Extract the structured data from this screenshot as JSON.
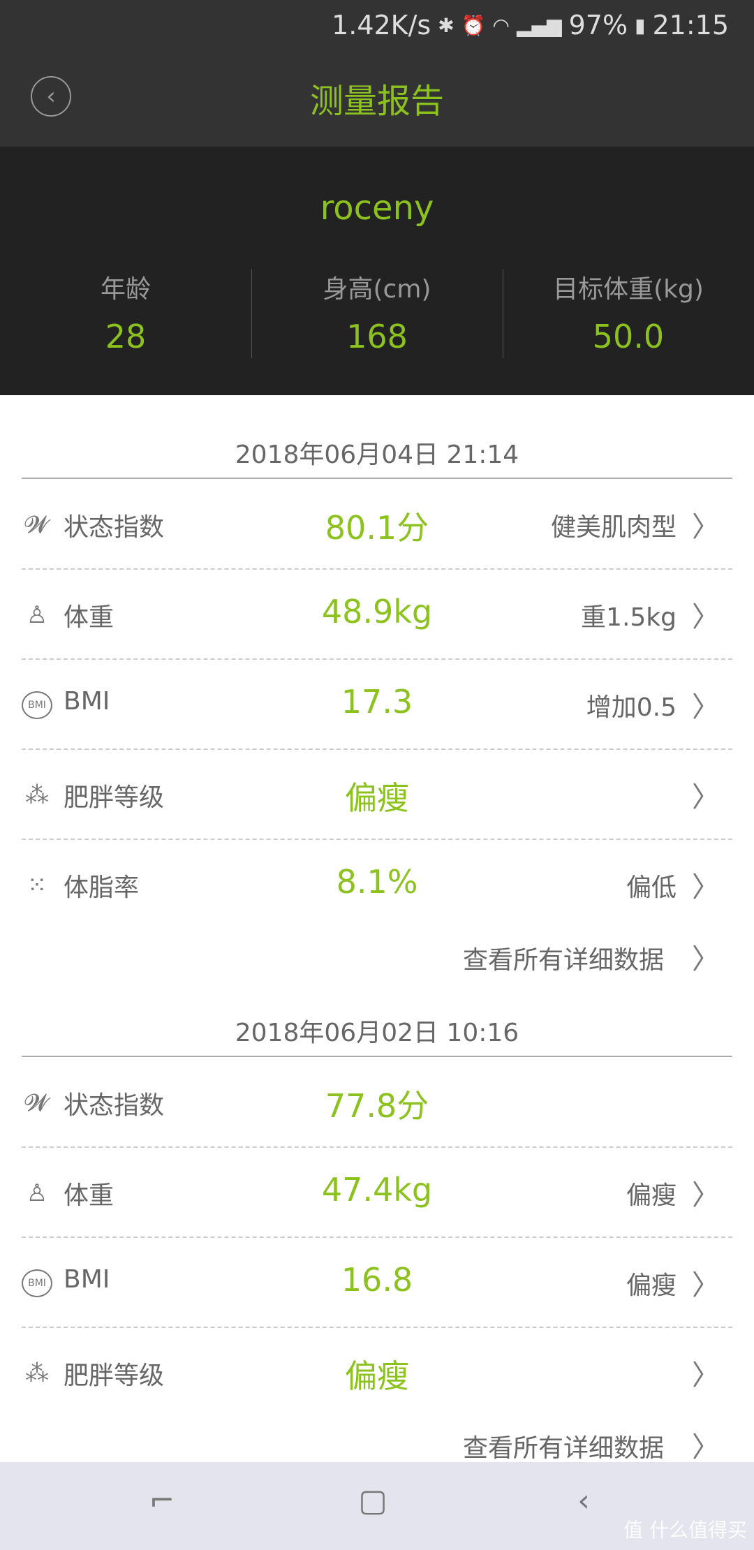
{
  "status_bar": {
    "speed": "1.42K/s",
    "battery": "97%",
    "time": "21:15",
    "icons": [
      "bluetooth-icon",
      "alarm-icon",
      "wifi-icon",
      "signal-3g-icon",
      "signal-4g-2g-icon",
      "battery-icon"
    ]
  },
  "header": {
    "title": "测量报告",
    "back_icon": "back-circle-icon"
  },
  "profile": {
    "name": "roceny",
    "stats": [
      {
        "label": "年龄",
        "value": "28"
      },
      {
        "label": "身高(cm)",
        "value": "168"
      },
      {
        "label": "目标体重(kg)",
        "value": "50.0"
      }
    ]
  },
  "reports": [
    {
      "date": "2018年06月04日 21:14",
      "rows": [
        {
          "icon": "trend-w-icon",
          "label": "状态指数",
          "value": "80.1分",
          "right": "健美肌肉型",
          "chevron": true
        },
        {
          "icon": "person-scale-icon",
          "label": "体重",
          "value": "48.9kg",
          "right": "重1.5kg",
          "chevron": true
        },
        {
          "icon": "bmi-icon",
          "label": "BMI",
          "value": "17.3",
          "right": "增加0.5",
          "chevron": true
        },
        {
          "icon": "stars-level-icon",
          "label": "肥胖等级",
          "value": "偏瘦",
          "right": "",
          "chevron": true
        },
        {
          "icon": "dots-fat-icon",
          "label": "体脂率",
          "value": "8.1%",
          "right": "偏低",
          "chevron": true
        }
      ],
      "more": "查看所有详细数据"
    },
    {
      "date": "2018年06月02日 10:16",
      "rows": [
        {
          "icon": "trend-w-icon",
          "label": "状态指数",
          "value": "77.8分",
          "right": "",
          "chevron": false
        },
        {
          "icon": "person-scale-icon",
          "label": "体重",
          "value": "47.4kg",
          "right": "偏瘦",
          "chevron": true
        },
        {
          "icon": "bmi-icon",
          "label": "BMI",
          "value": "16.8",
          "right": "偏瘦",
          "chevron": true
        },
        {
          "icon": "stars-level-icon",
          "label": "肥胖等级",
          "value": "偏瘦",
          "right": "",
          "chevron": true
        }
      ],
      "more": "查看所有详细数据"
    }
  ],
  "watermark": "值 什么值得买",
  "colors": {
    "accent": "#8cc21e",
    "header_bg": "#333333",
    "profile_bg": "#222222",
    "navbar_bg": "#e4e4ee"
  }
}
